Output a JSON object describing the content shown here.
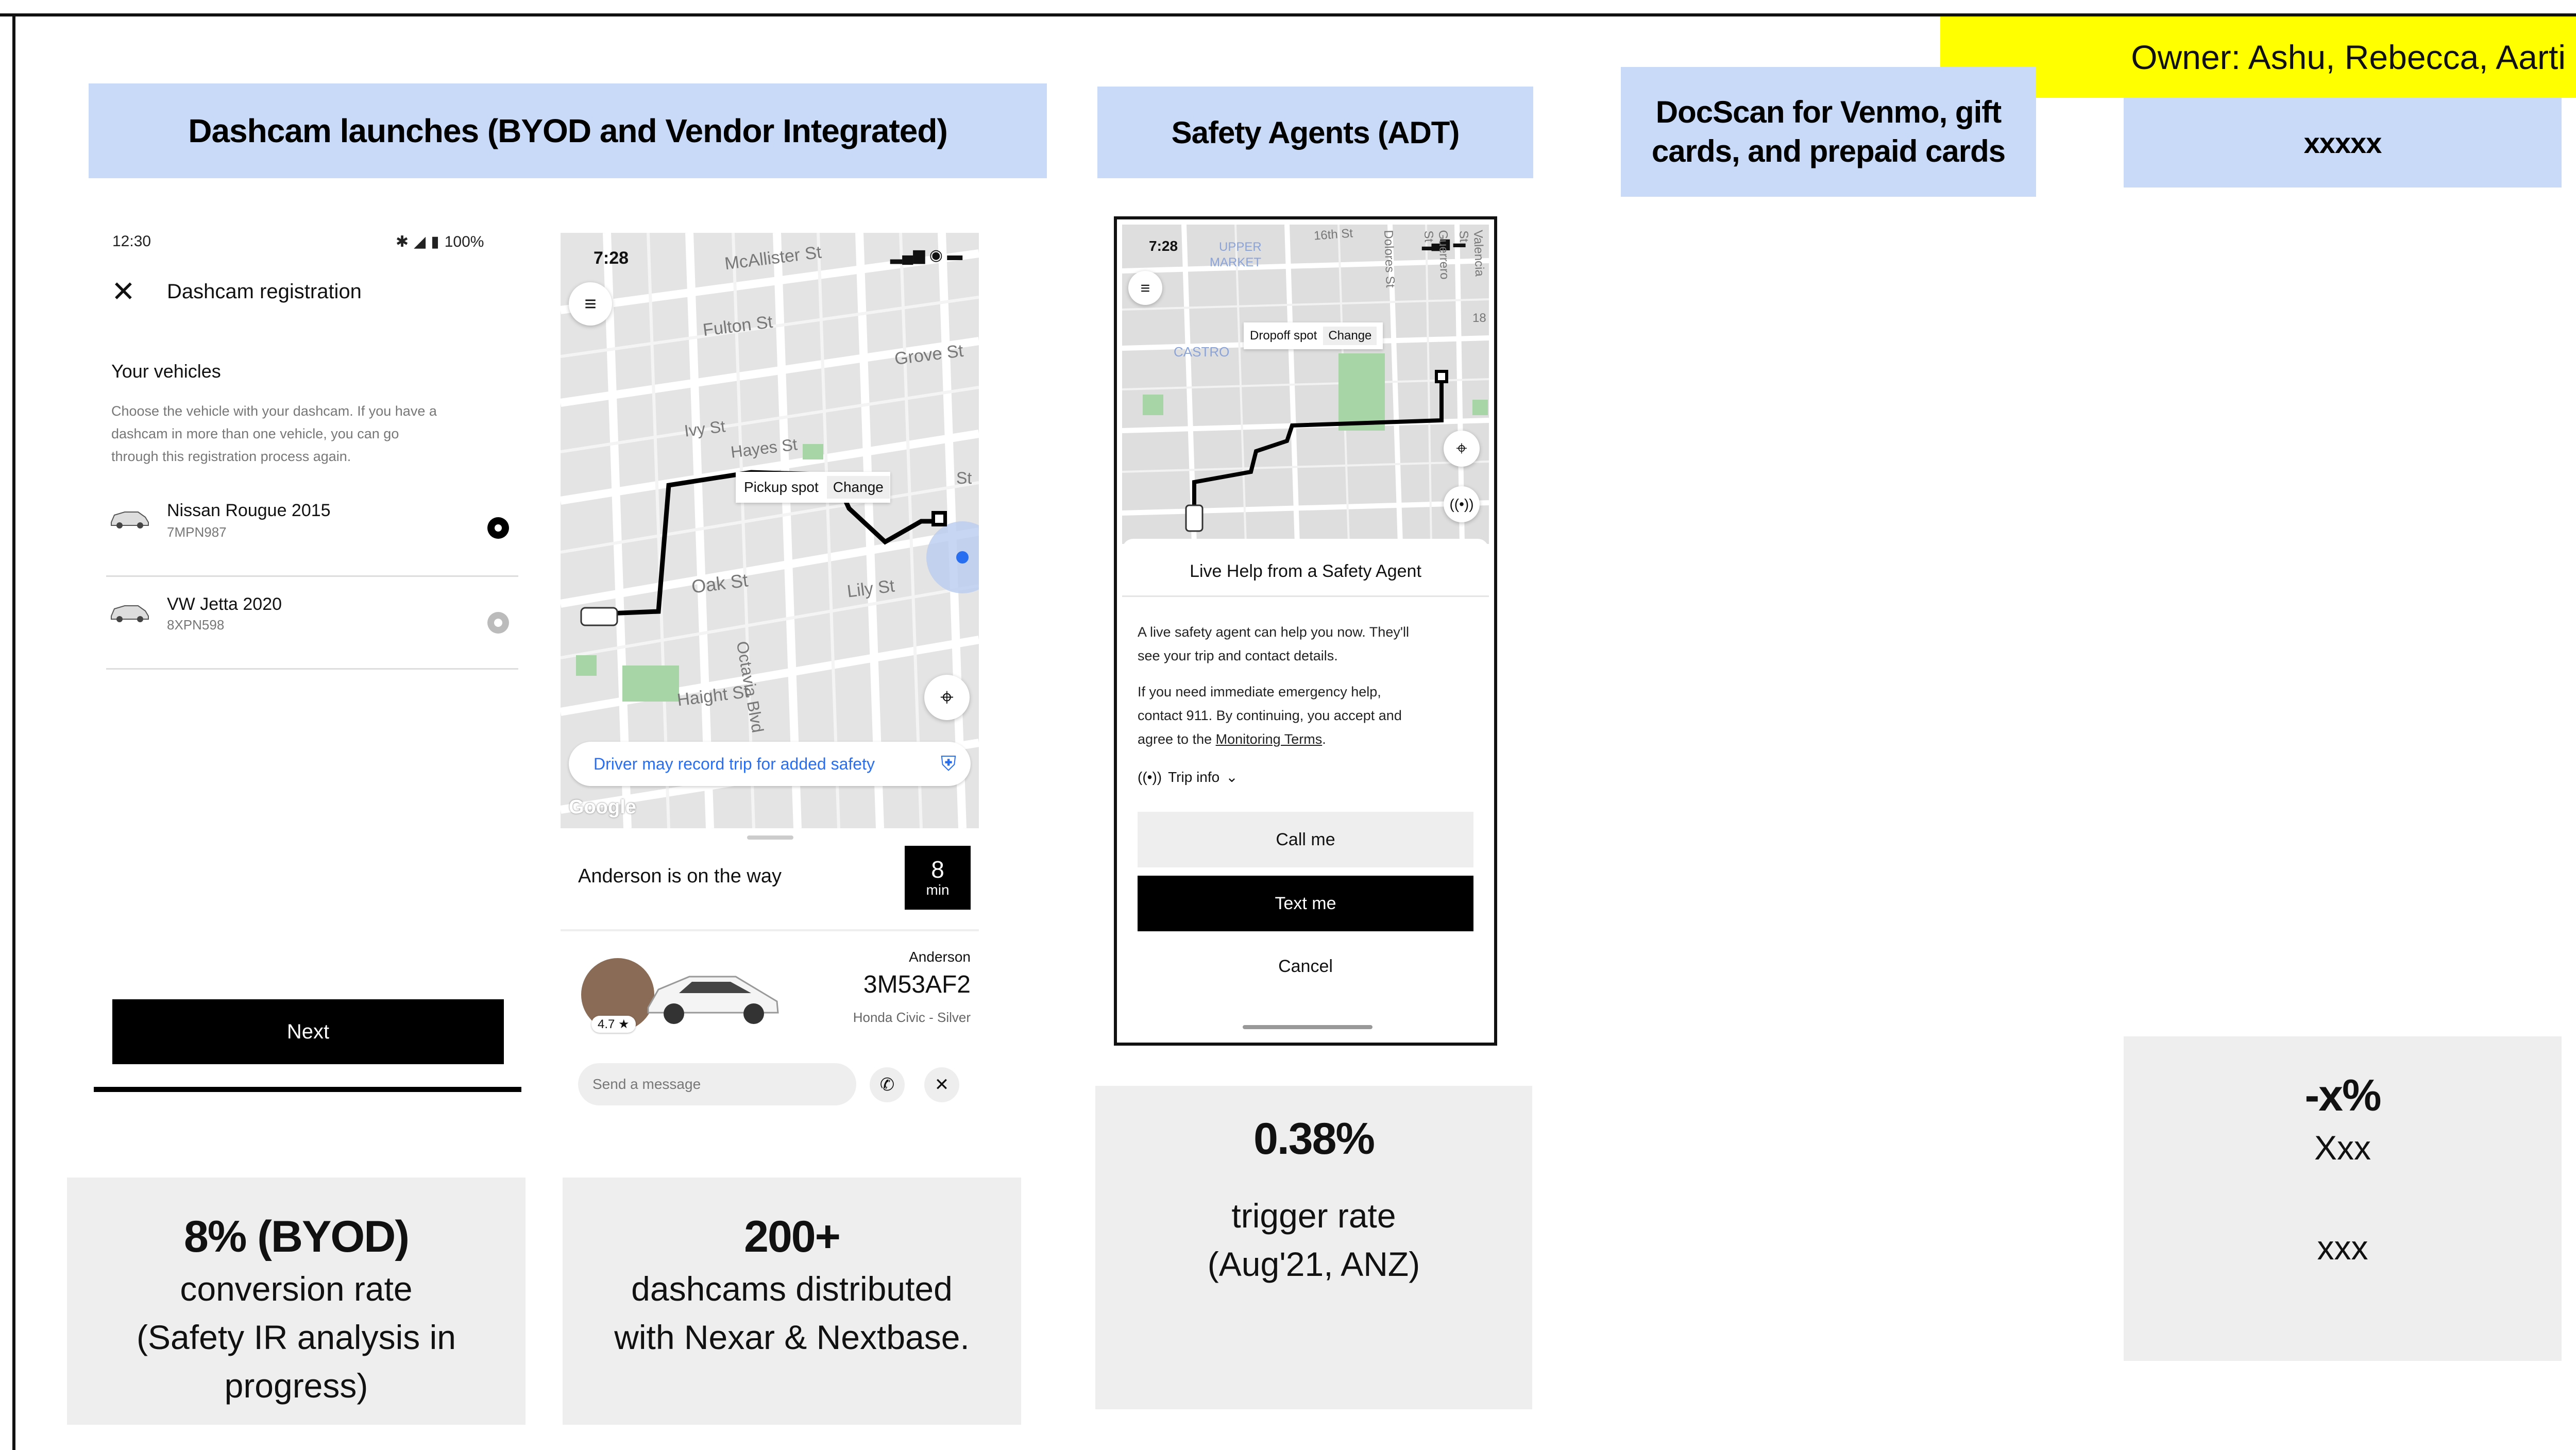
{
  "owner_label": "Owner: Ashu, Rebecca, Aarti",
  "headers": {
    "dashcam": "Dashcam launches (BYOD and Vendor Integrated)",
    "safety": "Safety Agents (ADT)",
    "docscan_line1": "DocScan for Venmo, gift",
    "docscan_line2": "cards, and prepaid cards",
    "xxxxx": "xxxxx"
  },
  "phone1": {
    "time": "12:30",
    "battery": "100%",
    "title": "Dashcam registration",
    "section": "Your vehicles",
    "desc1": "Choose the vehicle with your dashcam. If you have a",
    "desc2": "dashcam in more than one vehicle, you can go",
    "desc3": "through this registration process again.",
    "vehicles": [
      {
        "name": "Nissan Rougue 2015",
        "plate": "7MPN987"
      },
      {
        "name": "VW Jetta 2020",
        "plate": "8XPN598"
      }
    ],
    "next": "Next"
  },
  "phone2": {
    "time": "7:28",
    "streets": [
      "McAllister St",
      "Fulton St",
      "Grove St",
      "Ivy St",
      "Hayes St",
      "Oak St",
      "Lily St",
      "Haight St",
      "Octavia Blvd",
      "St"
    ],
    "pickup": "Pickup spot",
    "change": "Change",
    "banner": "Driver may record trip for added safety",
    "google": "Google",
    "status": "Anderson is on the way",
    "eta_num": "8",
    "eta_unit": "min",
    "driver": "Anderson",
    "plate": "3M53AF2",
    "car": "Honda Civic - Silver",
    "rating": "4.7 ★",
    "message_placeholder": "Send a message"
  },
  "phone3": {
    "time": "7:28",
    "map_labels": [
      "UPPER",
      "MARKET",
      "CASTRO",
      "16th St",
      "Dolores St",
      "Guerrero St",
      "Valencia St",
      "18"
    ],
    "dropoff": "Dropoff spot",
    "change": "Change",
    "sheet_title": "Live Help from a Safety Agent",
    "p1a": "A live safety agent can help you now. They'll",
    "p1b": "see your trip and contact details.",
    "p2a": "If you need immediate emergency help,",
    "p2b": "contact 911. By continuing, you accept and",
    "p2c": "agree to the",
    "terms": "Monitoring Terms",
    "trip_info": "Trip info",
    "call": "Call me",
    "text": "Text me",
    "cancel": "Cancel"
  },
  "stats": {
    "byod_big": "8% (BYOD)",
    "byod_1": "conversion rate",
    "byod_2": "(Safety IR analysis in",
    "byod_3": "progress)",
    "dash_big": "200+",
    "dash_1": "dashcams distributed",
    "dash_2": "with Nexar & Nextbase.",
    "trig_big": "0.38%",
    "trig_1": "trigger rate",
    "trig_2": "(Aug'21, ANZ)",
    "x_big": "-x%",
    "x_1": "Xxx",
    "x_2": "xxx"
  }
}
